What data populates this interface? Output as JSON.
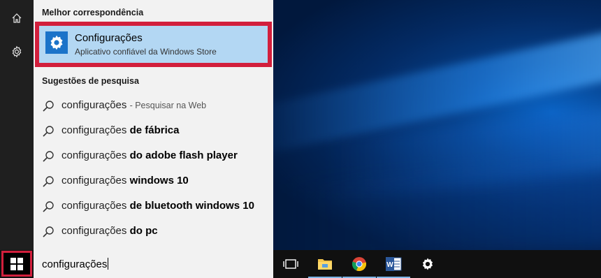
{
  "best_match": {
    "header": "Melhor correspondência",
    "title": "Configurações",
    "subtitle": "Aplicativo confiável da Windows Store",
    "icon": "gear-icon"
  },
  "suggestions": {
    "header": "Sugestões de pesquisa",
    "items": [
      {
        "query": "configurações",
        "bold": "",
        "hint": "- Pesquisar na Web"
      },
      {
        "query": "configurações",
        "bold": "de fábrica",
        "hint": ""
      },
      {
        "query": "configurações",
        "bold": "do adobe flash player",
        "hint": ""
      },
      {
        "query": "configurações",
        "bold": "windows 10",
        "hint": ""
      },
      {
        "query": "configurações",
        "bold": "de bluetooth windows 10",
        "hint": ""
      },
      {
        "query": "configurações",
        "bold": "do pc",
        "hint": ""
      }
    ]
  },
  "search": {
    "value": "configurações"
  },
  "rail": {
    "items": [
      "home-icon",
      "gear-icon"
    ]
  },
  "taskbar": {
    "apps": [
      "task-view-icon",
      "file-explorer-icon",
      "chrome-icon",
      "word-icon",
      "settings-icon"
    ]
  },
  "colors": {
    "highlight_border": "#d21f3c",
    "selection_bg": "#b3d7f3",
    "app_tile": "#1b73c9"
  }
}
